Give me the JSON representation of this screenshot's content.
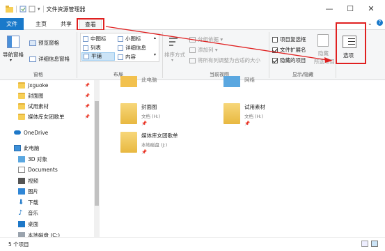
{
  "window": {
    "title": "文件资源管理器",
    "minimize": "—",
    "maximize": "☐",
    "close": "✕"
  },
  "tabs": {
    "file": "文件",
    "home": "主页",
    "share": "共享",
    "view": "查看"
  },
  "ribbon": {
    "pane": {
      "nav_pane": "导航窗格",
      "preview_pane": "预览窗格",
      "details_pane": "详细信息窗格",
      "label": "窗格"
    },
    "layout": {
      "medium_icons": "中图标",
      "small_icons": "小图标",
      "list": "列表",
      "details": "详细信息",
      "tiles": "平铺",
      "content": "内容",
      "label": "布局"
    },
    "current_view": {
      "sort_by": "排序方式",
      "group_by": "分组依据",
      "add_columns": "添加列",
      "fit_columns": "将所有列调整为合适的大小",
      "label": "当前视图"
    },
    "show_hide": {
      "item_checkboxes": "项目复选框",
      "file_extensions": "文件扩展名",
      "hidden_items": "隐藏的项目",
      "hide": "隐藏",
      "hide_selected": "所选项目",
      "label": "显示/隐藏"
    },
    "options": "选项"
  },
  "nav": {
    "items": [
      {
        "label": "jxguoke",
        "pinned": true
      },
      {
        "label": "封面图",
        "pinned": true
      },
      {
        "label": "试用素材",
        "pinned": true
      },
      {
        "label": "媒体库女团歌单",
        "pinned": true
      },
      {
        "label": "OneDrive",
        "pinned": false
      },
      {
        "label": "此电脑",
        "pinned": false
      },
      {
        "label": "3D 对象",
        "pinned": false
      },
      {
        "label": "Documents",
        "pinned": false
      },
      {
        "label": "视频",
        "pinned": false
      },
      {
        "label": "图片",
        "pinned": false
      },
      {
        "label": "下载",
        "pinned": false
      },
      {
        "label": "音乐",
        "pinned": false
      },
      {
        "label": "桌面",
        "pinned": false
      },
      {
        "label": "本地磁盘 (C:)",
        "pinned": false
      }
    ]
  },
  "content": {
    "items": [
      {
        "name": "此电脑",
        "sub": ""
      },
      {
        "name": "网络",
        "sub": ""
      },
      {
        "name": "封面图",
        "sub": "文档 (H:)"
      },
      {
        "name": "试用素材",
        "sub": "文档 (H:)"
      },
      {
        "name": "媒体库女团歌单",
        "sub": "本地磁盘 (J:)"
      }
    ]
  },
  "status": {
    "count": "5 个项目"
  },
  "colors": {
    "accent": "#1979ca",
    "highlight": "#e02020"
  }
}
